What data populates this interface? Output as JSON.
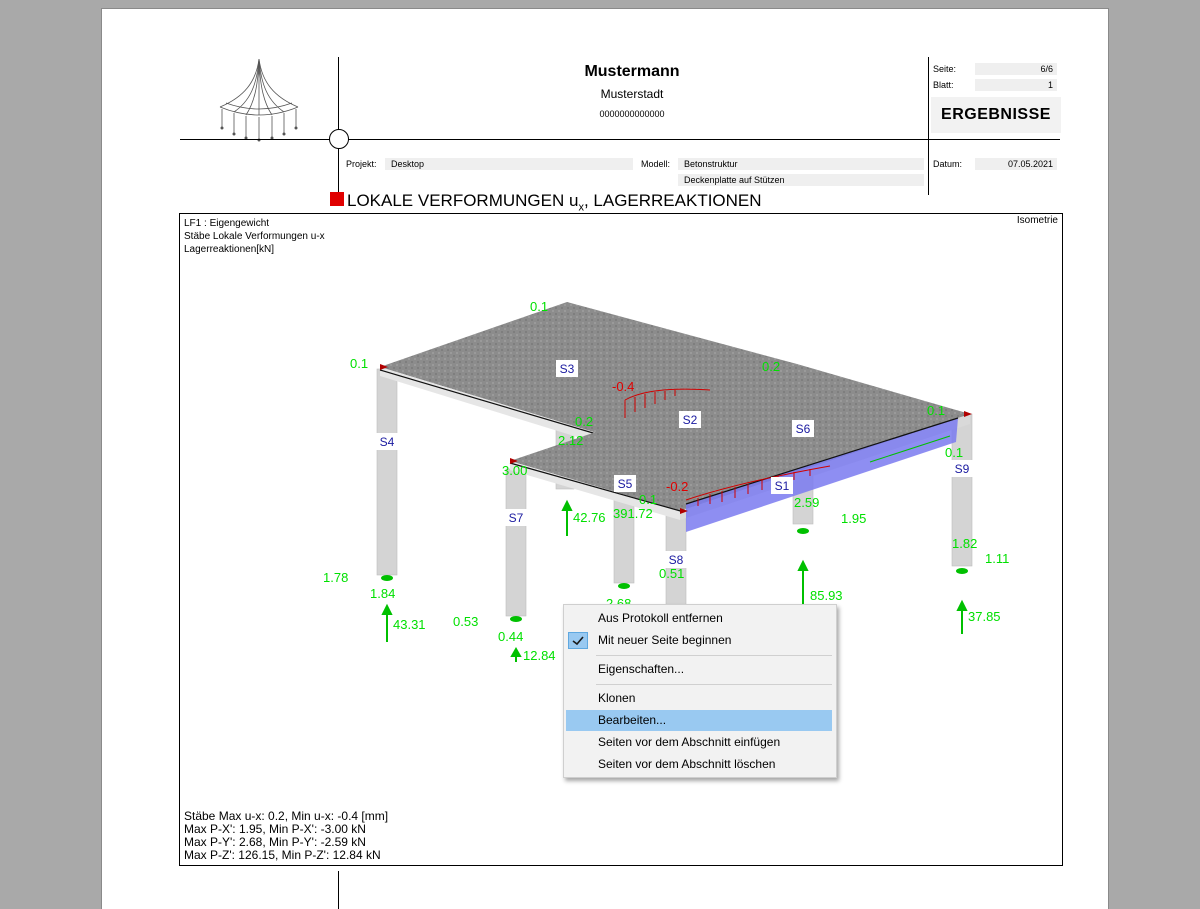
{
  "header": {
    "company_name": "Mustermann",
    "company_city": "Musterstadt",
    "company_number": "0000000000000",
    "seite_label": "Seite:",
    "seite_value": "6/6",
    "blatt_label": "Blatt:",
    "blatt_value": "1",
    "section": "ERGEBNISSE",
    "projekt_label": "Projekt:",
    "projekt_value": "Desktop",
    "modell_label": "Modell:",
    "modell_value": "Betonstruktur",
    "modell_desc": "Deckenplatte auf Stützen",
    "datum_label": "Datum:",
    "datum_value": "07.05.2021"
  },
  "title": {
    "prefix": "LOKALE VERFORMUNGEN u",
    "subscript": "x",
    "suffix": ", LAGERREAKTIONEN"
  },
  "figure": {
    "lf": "LF1 : Eigengewicht",
    "line2": "Stäbe Lokale Verformungen u-x",
    "line3": "Lagerreaktionen[kN]",
    "view": "Isometrie",
    "members": [
      "S1",
      "S2",
      "S3",
      "S4",
      "S5",
      "S6",
      "S7",
      "S8",
      "S9"
    ],
    "values": [
      "0.1",
      "0.1",
      "0.2",
      "-0.4",
      "0.2",
      "2.12",
      "3.00",
      "-0.2",
      "0.1",
      "391.72",
      "0.1",
      "0.1",
      "42.76",
      "2.59",
      "1.95",
      "0.51",
      "1.82",
      "1.11",
      "1.78",
      "1.84",
      "2.68",
      "85.93",
      "43.31",
      "0.53",
      "0.44",
      "12.84",
      "37.85"
    ],
    "summary": [
      "Stäbe Max u-x: 0.2, Min u-x: -0.4 [mm]",
      "Max P-X': 1.95, Min P-X': -3.00 kN",
      "Max P-Y': 2.68, Min P-Y': -2.59 kN",
      "Max P-Z': 126.15, Min P-Z': 12.84 kN"
    ]
  },
  "context_menu": {
    "items": [
      {
        "label": "Aus Protokoll entfernen"
      },
      {
        "label": "Mit neuer Seite beginnen",
        "checked": true
      },
      {
        "label": "Eigenschaften..."
      },
      {
        "label": "Klonen"
      },
      {
        "label": "Bearbeiten...",
        "highlighted": true
      },
      {
        "label": "Seiten vor dem Abschnitt einfügen"
      },
      {
        "label": "Seiten vor dem Abschnitt löschen"
      }
    ]
  },
  "colors": {
    "deformation": "#e00000",
    "reaction": "#00e000",
    "accent": "#99c9f1",
    "marker": "#e00000"
  }
}
